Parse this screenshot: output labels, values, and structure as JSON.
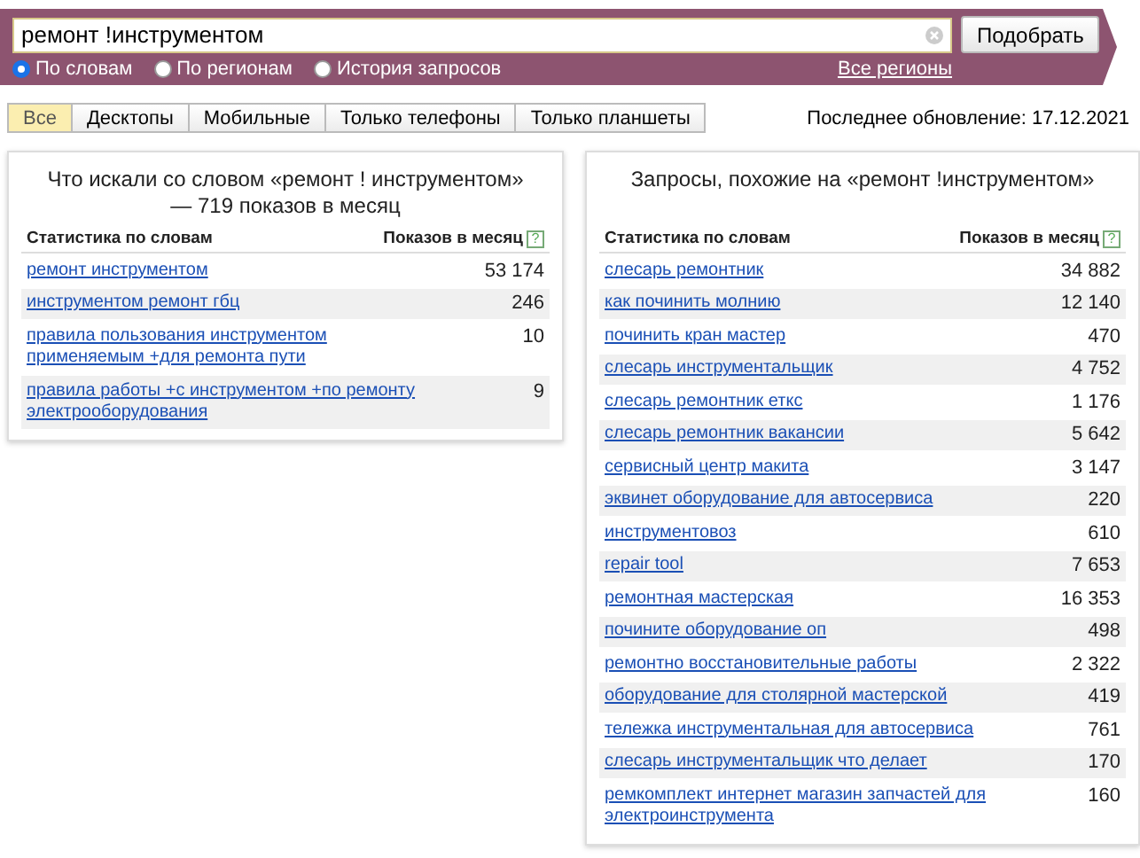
{
  "search": {
    "value": "ремонт !инструментом",
    "button": "Подобрать"
  },
  "modes": [
    {
      "label": "По словам",
      "selected": true
    },
    {
      "label": "По регионам",
      "selected": false
    },
    {
      "label": "История запросов",
      "selected": false
    }
  ],
  "regions_link": "Все регионы",
  "tabs": [
    {
      "label": "Все",
      "selected": true
    },
    {
      "label": "Десктопы",
      "selected": false
    },
    {
      "label": "Мобильные",
      "selected": false
    },
    {
      "label": "Только телефоны",
      "selected": false
    },
    {
      "label": "Только планшеты",
      "selected": false
    }
  ],
  "last_update": "Последнее обновление: 17.12.2021",
  "panels": [
    {
      "title": "Что искали со словом «ремонт ! инструментом» — 719 показов в месяц",
      "columns": [
        "Статистика по словам",
        "Показов в месяц"
      ],
      "help": "?",
      "rows": [
        {
          "query": "ремонт инструментом",
          "count": "53 174"
        },
        {
          "query": "инструментом ремонт гбц",
          "count": "246"
        },
        {
          "query": "правила пользования инструментом применяемым +для ремонта пути",
          "count": "10"
        },
        {
          "query": "правила работы +с инструментом +по ремонту электрооборудования",
          "count": "9"
        }
      ]
    },
    {
      "title": "Запросы, похожие на «ремонт !инструментом»",
      "columns": [
        "Статистика по словам",
        "Показов в месяц"
      ],
      "help": "?",
      "rows": [
        {
          "query": "слесарь ремонтник",
          "count": "34 882"
        },
        {
          "query": "как починить молнию",
          "count": "12 140"
        },
        {
          "query": "починить кран мастер",
          "count": "470"
        },
        {
          "query": "слесарь инструментальщик",
          "count": "4 752"
        },
        {
          "query": "слесарь ремонтник еткс",
          "count": "1 176"
        },
        {
          "query": "слесарь ремонтник вакансии",
          "count": "5 642"
        },
        {
          "query": "сервисный центр макита",
          "count": "3 147"
        },
        {
          "query": "эквинет оборудование для автосервиса",
          "count": "220"
        },
        {
          "query": "инструментовоз",
          "count": "610"
        },
        {
          "query": "repair tool",
          "count": "7 653"
        },
        {
          "query": "ремонтная мастерская",
          "count": "16 353"
        },
        {
          "query": "почините оборудование оп",
          "count": "498"
        },
        {
          "query": "ремонтно восстановительные работы",
          "count": "2 322"
        },
        {
          "query": "оборудование для столярной мастерской",
          "count": "419"
        },
        {
          "query": "тележка инструментальная для автосервиса",
          "count": "761"
        },
        {
          "query": "слесарь инструментальщик что делает",
          "count": "170"
        },
        {
          "query": "ремкомплект интернет магазин запчастей для электроинструмента",
          "count": "160"
        }
      ]
    }
  ]
}
